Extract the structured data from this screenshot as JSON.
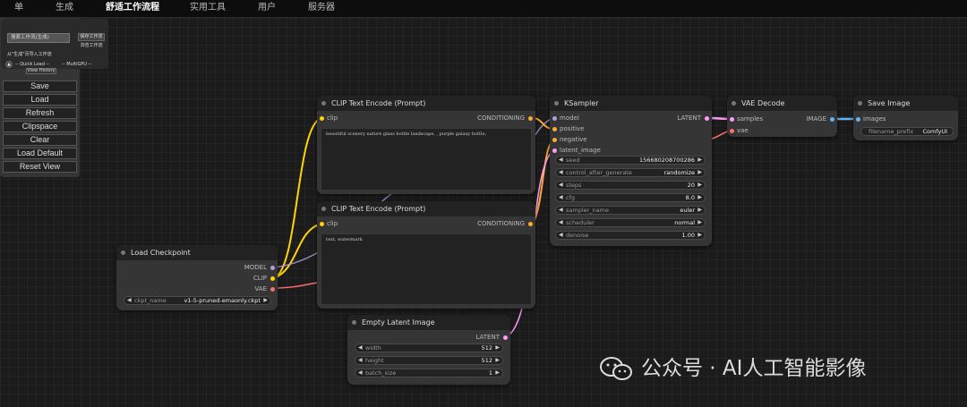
{
  "topbar": {
    "items": [
      "单",
      "生成",
      "舒适工作流程",
      "实用工具",
      "用户",
      "服务器"
    ],
    "active_index": 2
  },
  "workflow_panel": {
    "title": "",
    "input_placeholder": "搜索工作流(生成)",
    "save_label": "保存工作流",
    "browse_label": "浏览工作流",
    "import_label": "从\"生成\"页导入工作流",
    "quick_load": "-- Quick Load --",
    "gpu_select": "-- MultiGPU --",
    "view_history": "View History"
  },
  "menu": {
    "buttons": [
      "Save",
      "Load",
      "Refresh",
      "Clipspace",
      "Clear",
      "Load Default",
      "Reset View"
    ]
  },
  "nodes": {
    "clip_pos": {
      "title": "CLIP Text Encode (Prompt)",
      "input": "clip",
      "output": "CONDITIONING",
      "text": "beautiful scenery nature glass bottle landscape, , purple galaxy bottle,"
    },
    "clip_neg": {
      "title": "CLIP Text Encode (Prompt)",
      "input": "clip",
      "output": "CONDITIONING",
      "text": "text, watermark"
    },
    "checkpoint": {
      "title": "Load Checkpoint",
      "outputs": [
        "MODEL",
        "CLIP",
        "VAE"
      ],
      "widget_name": "ckpt_name",
      "widget_value": "v1-5-pruned-emaonly.ckpt"
    },
    "ksampler": {
      "title": "KSampler",
      "inputs": [
        "model",
        "positive",
        "negative",
        "latent_image"
      ],
      "output": "LATENT",
      "widgets": [
        {
          "name": "seed",
          "value": "156680208700286"
        },
        {
          "name": "control_after_generate",
          "value": "randomize"
        },
        {
          "name": "steps",
          "value": "20"
        },
        {
          "name": "cfg",
          "value": "8.0"
        },
        {
          "name": "sampler_name",
          "value": "euler"
        },
        {
          "name": "scheduler",
          "value": "normal"
        },
        {
          "name": "denoise",
          "value": "1.00"
        }
      ]
    },
    "vae_decode": {
      "title": "VAE Decode",
      "inputs": [
        "samples",
        "vae"
      ],
      "output": "IMAGE"
    },
    "save_image": {
      "title": "Save Image",
      "input": "images",
      "widget_name": "filename_prefix",
      "widget_value": "ComfyUI"
    },
    "empty_latent": {
      "title": "Empty Latent Image",
      "output": "LATENT",
      "widgets": [
        {
          "name": "width",
          "value": "512"
        },
        {
          "name": "height",
          "value": "512"
        },
        {
          "name": "batch_size",
          "value": "1"
        }
      ]
    }
  },
  "watermark": {
    "text": "公众号 · AI人工智能影像",
    "icon": "wechat-icon"
  },
  "colors": {
    "clip": "#ffd500",
    "conditioning": "#ffa931",
    "model": "#b39ddb",
    "vae": "#ff6e6e",
    "latent": "#ff9cf9",
    "image": "#64b5f6",
    "node_bg": "#353535",
    "node_title": "#222222",
    "canvas": "#1b1b1b"
  }
}
